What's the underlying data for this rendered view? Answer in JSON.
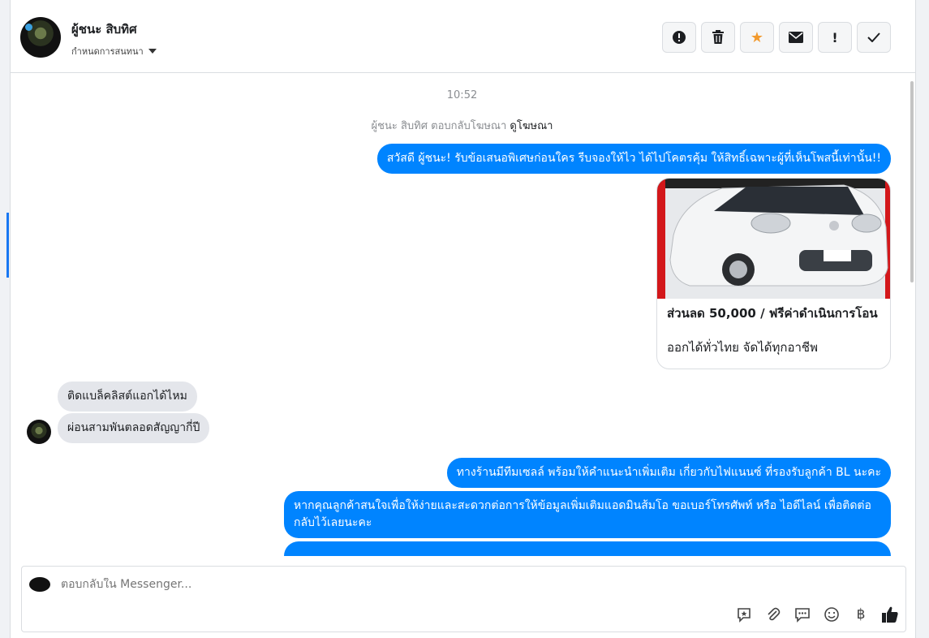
{
  "header": {
    "contact_name": "ผู้ชนะ สิบทิศ",
    "assign_label": "กำหนดการสนทนา"
  },
  "actions": [
    {
      "name": "mark-spam-button",
      "icon": "alert-circle-icon"
    },
    {
      "name": "delete-button",
      "icon": "trash-icon"
    },
    {
      "name": "star-button",
      "icon": "star-icon"
    },
    {
      "name": "mark-unread-button",
      "icon": "envelope-icon"
    },
    {
      "name": "follow-up-button",
      "icon": "exclamation-icon"
    },
    {
      "name": "mark-done-button",
      "icon": "check-icon"
    }
  ],
  "conversation": {
    "time": "10:52",
    "ad_reply_note": "ผู้ชนะ สิบทิศ ตอบกลับโฆษณา",
    "ad_link": "ดูโฆษณา",
    "greeting": "สวัสดี ผู้ชนะ! รับข้อเสนอพิเศษก่อนใคร รีบจองให้ไว ได้ไปโคตรคุ้ม ให้สิทธิ์เฉพาะผู้ที่เห็นโพสนี้เท่านั้น!!",
    "card_title": "ส่วนลด 50,000 / ฟรีค่าดำเนินการโอน",
    "card_subtitle": "ออกได้ทั่วไทย จัดได้ทุกอาชีพ",
    "incoming_1": "ติดแบล็คลิสต์แอกได้ไหม",
    "incoming_2": "ผ่อนสามพันตลอดสัญญากี่ปี",
    "outgoing_1": "ทางร้านมีทีมเซลล์ พร้อมให้คำแนะนำเพิ่มเติม เกี่ยวกับไฟแนนซ์ ที่รองรับลูกค้า BL นะคะ",
    "outgoing_2": "หากคุณลูกค้าสนใจเพื่อให้ง่ายและสะดวกต่อการให้ข้อมูลเพิ่มเติมแอดมินส้มโอ ขอเบอร์โทรศัพท์ หรือ ไอดีไลน์ เพื่อติดต่อกลับไว้เลยนะคะ"
  },
  "composer": {
    "placeholder": "ตอบกลับใน Messenger..."
  },
  "colors": {
    "outgoing_bubble": "#0084ff",
    "incoming_bubble": "#e4e6eb",
    "star": "#f29a2e"
  }
}
